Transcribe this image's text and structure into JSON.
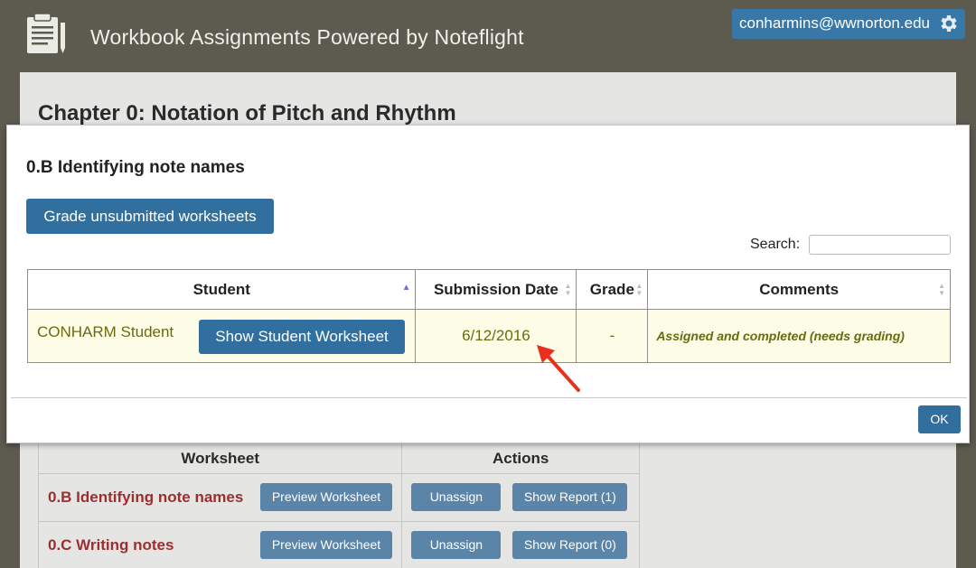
{
  "header": {
    "app_title": "Workbook Assignments Powered by Noteflight",
    "user_email": "conharmins@wwnorton.edu"
  },
  "page": {
    "chapter_title": "Chapter 0: Notation of Pitch and Rhythm",
    "table": {
      "headers": [
        "Worksheet",
        "Actions"
      ],
      "rows": [
        {
          "name": "0.B Identifying note names",
          "preview": "Preview Worksheet",
          "unassign": "Unassign",
          "report": "Show Report (1)"
        },
        {
          "name": "0.C Writing notes",
          "preview": "Preview Worksheet",
          "unassign": "Unassign",
          "report": "Show Report (0)"
        }
      ]
    }
  },
  "modal": {
    "title": "0.B Identifying note names",
    "grade_button": "Grade unsubmitted worksheets",
    "search_label": "Search:",
    "search_value": "",
    "columns": [
      "Student",
      "Submission Date",
      "Grade",
      "Comments"
    ],
    "row": {
      "student": "CONHARM Student",
      "show_button": "Show Student Worksheet",
      "date": "6/12/2016",
      "grade": "-",
      "comment": "Assigned and completed (needs grading)"
    },
    "ok_button": "OK"
  },
  "colors": {
    "header_bg": "#5d5a4f",
    "button_blue": "#31709e",
    "row_highlight": "#fdfde7",
    "worksheet_red": "#9b2f2f",
    "annotation_arrow": "#e8301c"
  }
}
